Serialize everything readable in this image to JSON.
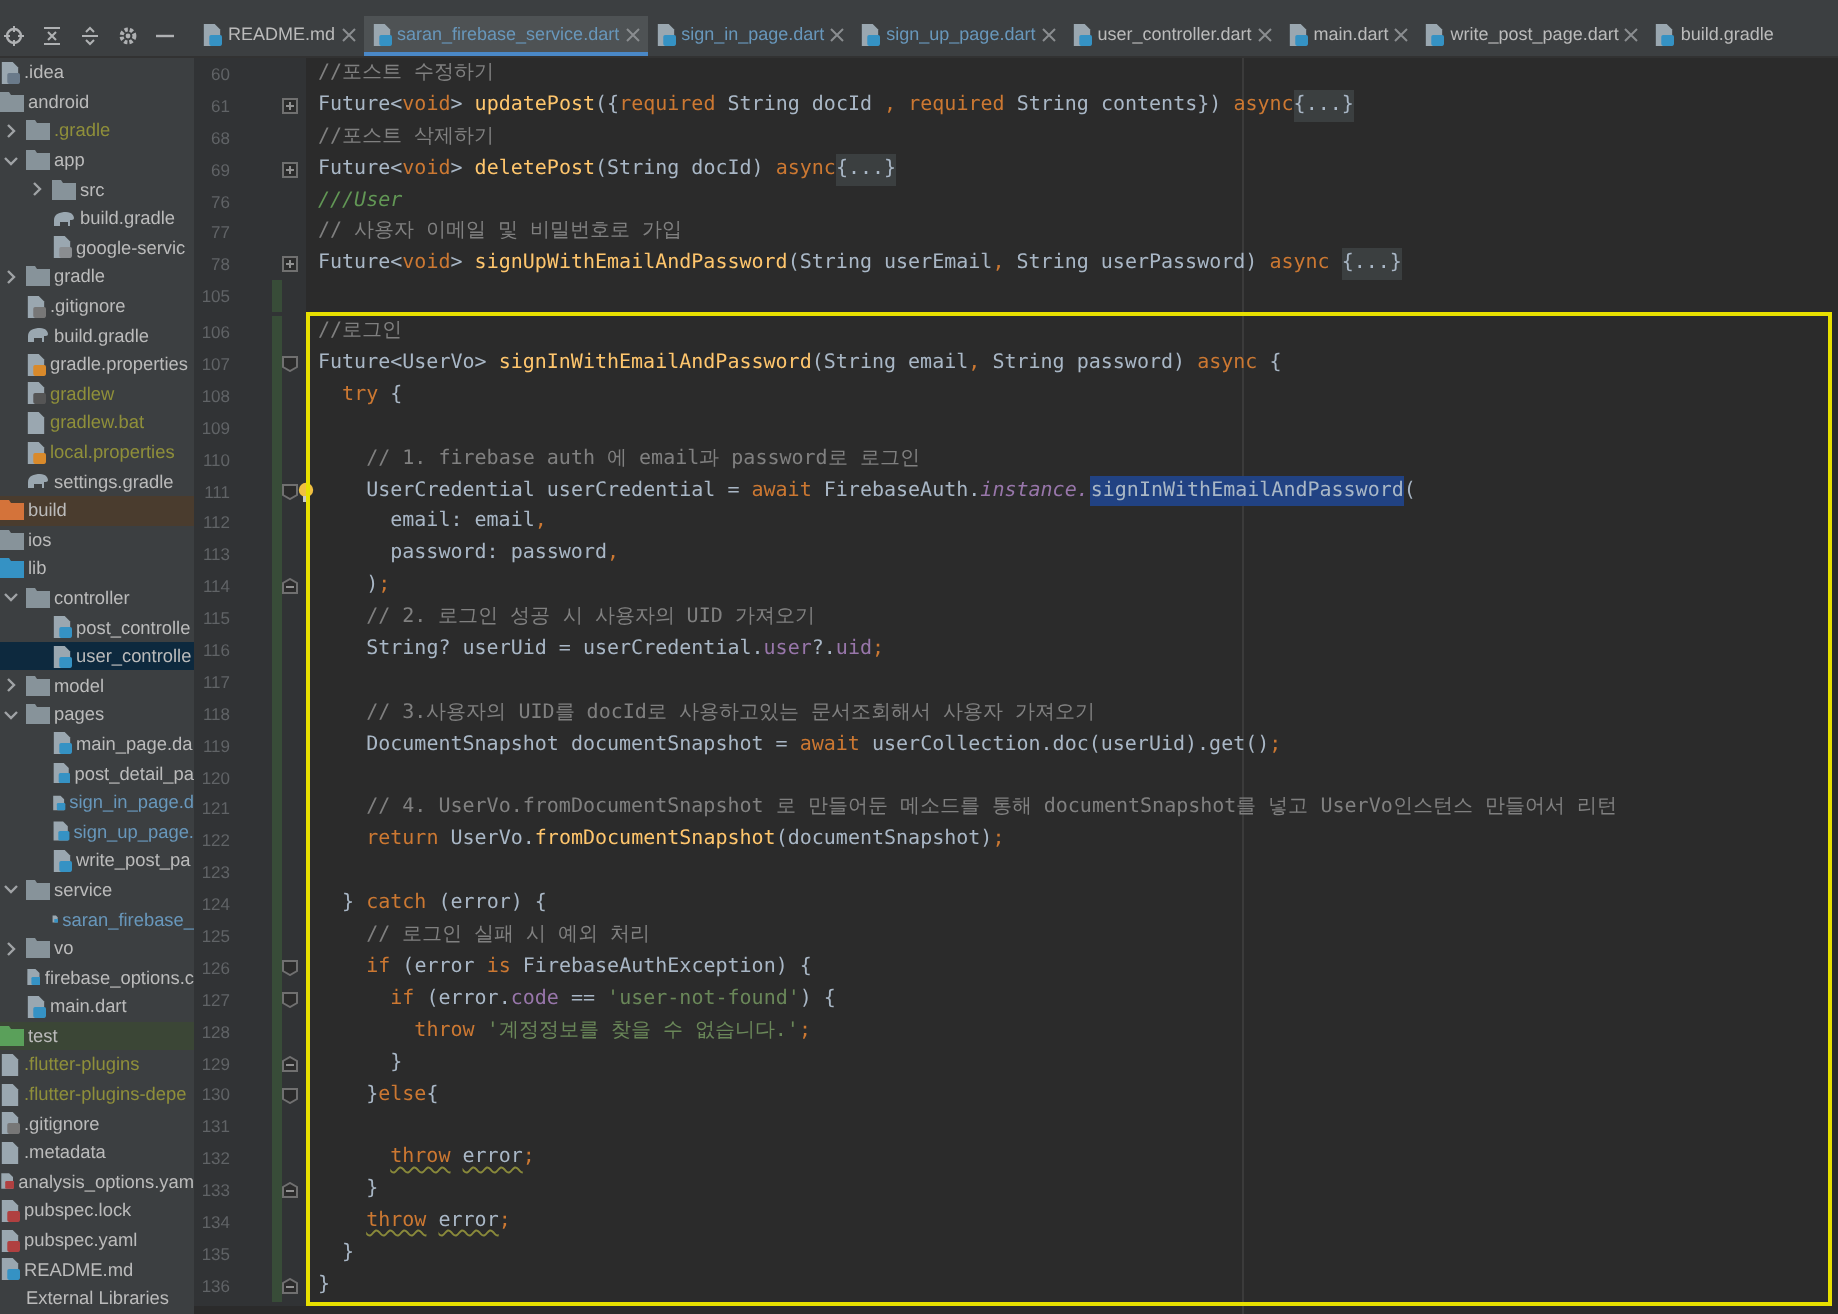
{
  "tabs": [
    {
      "label": "README.md",
      "color": "#bbbbbb",
      "selected": false
    },
    {
      "label": "saran_firebase_service.dart",
      "color": "#6897bb",
      "selected": true
    },
    {
      "label": "sign_in_page.dart",
      "color": "#6897bb",
      "selected": false
    },
    {
      "label": "sign_up_page.dart",
      "color": "#6897bb",
      "selected": false
    },
    {
      "label": "user_controller.dart",
      "color": "#bbbbbb",
      "selected": false
    },
    {
      "label": "main.dart",
      "color": "#bbbbbb",
      "selected": false
    },
    {
      "label": "write_post_page.dart",
      "color": "#bbbbbb",
      "selected": false
    },
    {
      "label": "build.gradle",
      "color": "#bbbbbb",
      "selected": false
    }
  ],
  "sidebar": {
    "tree": [
      {
        "label": ".idea",
        "kind": "module",
        "color": "#bbbbbb",
        "selected": false
      },
      {
        "label": "android",
        "kind": "folder",
        "color": "#bbbbbb",
        "selected": false,
        "children": [
          {
            "label": ".gradle",
            "kind": "folder",
            "color": "#8f8f3a",
            "selected": false,
            "expanded": false
          },
          {
            "label": "app",
            "kind": "folder",
            "color": "#bbbbbb",
            "selected": false,
            "expanded": true,
            "children": [
              {
                "label": "src",
                "kind": "folder",
                "color": "#bbbbbb",
                "selected": false,
                "expanded": false
              },
              {
                "label": "build.gradle",
                "kind": "gradle",
                "color": "#bbbbbb",
                "selected": false
              },
              {
                "label": "google-servic",
                "kind": "json",
                "color": "#bbbbbb",
                "selected": false
              }
            ]
          },
          {
            "label": "gradle",
            "kind": "folder",
            "color": "#bbbbbb",
            "selected": false,
            "expanded": false
          },
          {
            "label": ".gitignore",
            "kind": "ignorefile",
            "color": "#bbbbbb",
            "selected": false
          },
          {
            "label": "build.gradle",
            "kind": "gradle",
            "color": "#bbbbbb",
            "selected": false
          },
          {
            "label": "gradle.properties",
            "kind": "properties",
            "color": "#bbbbbb",
            "selected": false
          },
          {
            "label": "gradlew",
            "kind": "script",
            "color": "#8f8f3a",
            "selected": false
          },
          {
            "label": "gradlew.bat",
            "kind": "text",
            "color": "#8f8f3a",
            "selected": false
          },
          {
            "label": "local.properties",
            "kind": "properties",
            "color": "#8f8f3a",
            "selected": false
          },
          {
            "label": "settings.gradle",
            "kind": "gradle",
            "color": "#bbbbbb",
            "selected": false
          }
        ]
      },
      {
        "label": "build",
        "kind": "excluded-folder",
        "color": "#bbbbbb",
        "selected": false
      },
      {
        "label": "ios",
        "kind": "folder",
        "color": "#bbbbbb",
        "selected": false
      },
      {
        "label": "lib",
        "kind": "source-folder",
        "color": "#bbbbbb",
        "selected": false,
        "children": [
          {
            "label": "controller",
            "kind": "folder",
            "color": "#bbbbbb",
            "selected": false,
            "expanded": true,
            "children": [
              {
                "label": "post_controlle",
                "kind": "dart",
                "color": "#bbbbbb",
                "selected": false
              },
              {
                "label": "user_controlle",
                "kind": "dart",
                "color": "#bbbbbb",
                "selected": true
              }
            ]
          },
          {
            "label": "model",
            "kind": "folder",
            "color": "#bbbbbb",
            "selected": false,
            "expanded": false
          },
          {
            "label": "pages",
            "kind": "folder",
            "color": "#bbbbbb",
            "selected": false,
            "expanded": true,
            "children": [
              {
                "label": "main_page.da",
                "kind": "dart",
                "color": "#bbbbbb",
                "selected": false
              },
              {
                "label": "post_detail_pa",
                "kind": "dart",
                "color": "#bbbbbb",
                "selected": false
              },
              {
                "label": "sign_in_page.d",
                "kind": "dart",
                "color": "#6897bb",
                "selected": false
              },
              {
                "label": "sign_up_page.",
                "kind": "dart",
                "color": "#6897bb",
                "selected": false
              },
              {
                "label": "write_post_pa",
                "kind": "dart",
                "color": "#bbbbbb",
                "selected": false
              }
            ]
          },
          {
            "label": "service",
            "kind": "folder",
            "color": "#bbbbbb",
            "selected": false,
            "expanded": true,
            "children": [
              {
                "label": "saran_firebase_",
                "kind": "dart",
                "color": "#6897bb",
                "selected": false
              }
            ]
          },
          {
            "label": "vo",
            "kind": "folder",
            "color": "#bbbbbb",
            "selected": false,
            "expanded": false
          },
          {
            "label": "firebase_options.c",
            "kind": "dart",
            "color": "#bbbbbb",
            "selected": false
          },
          {
            "label": "main.dart",
            "kind": "dart",
            "color": "#bbbbbb",
            "selected": false
          }
        ]
      },
      {
        "label": "test",
        "kind": "test-folder",
        "color": "#bbbbbb",
        "selected": false
      },
      {
        "label": ".flutter-plugins",
        "kind": "text",
        "color": "#8f8f3a",
        "selected": false
      },
      {
        "label": ".flutter-plugins-depe",
        "kind": "text",
        "color": "#8f8f3a",
        "selected": false
      },
      {
        "label": ".gitignore",
        "kind": "ignorefile",
        "color": "#bbbbbb",
        "selected": false
      },
      {
        "label": ".metadata",
        "kind": "text",
        "color": "#bbbbbb",
        "selected": false
      },
      {
        "label": "analysis_options.yam",
        "kind": "yaml",
        "color": "#bbbbbb",
        "selected": false
      },
      {
        "label": "pubspec.lock",
        "kind": "yaml",
        "color": "#bbbbbb",
        "selected": false
      },
      {
        "label": "pubspec.yaml",
        "kind": "yaml",
        "color": "#bbbbbb",
        "selected": false
      },
      {
        "label": "README.md",
        "kind": "markdown",
        "color": "#bbbbbb",
        "selected": false
      },
      {
        "label": "External Libraries",
        "kind": "library",
        "color": "#bbbbbb",
        "selected": false
      }
    ]
  },
  "editor": {
    "lines": [
      {
        "number": "60",
        "kind": "plain",
        "changed": false,
        "bulb": false,
        "tokens": [
          {
            "kind": "comment",
            "text": "//포스트 수정하기"
          }
        ]
      },
      {
        "number": "61",
        "kind": "collapsed",
        "changed": false,
        "bulb": false,
        "tokens": [
          {
            "kind": "plain",
            "text": "Future<"
          },
          {
            "kind": "keyword",
            "text": "void"
          },
          {
            "kind": "plain",
            "text": "> "
          },
          {
            "kind": "function",
            "text": "updatePost"
          },
          {
            "kind": "plain",
            "text": "({"
          },
          {
            "kind": "keyword",
            "text": "required"
          },
          {
            "kind": "plain",
            "text": " String docId "
          },
          {
            "kind": "keyword",
            "text": ","
          },
          {
            "kind": "keyword",
            "text": " required"
          },
          {
            "kind": "plain",
            "text": " String contents}) "
          },
          {
            "kind": "keyword",
            "text": "async"
          },
          {
            "kind": "folded",
            "text": "{...}"
          }
        ]
      },
      {
        "number": "68",
        "kind": "plain",
        "changed": false,
        "bulb": false,
        "tokens": [
          {
            "kind": "comment",
            "text": "//포스트 삭제하기"
          }
        ]
      },
      {
        "number": "69",
        "kind": "collapsed",
        "changed": false,
        "bulb": false,
        "tokens": [
          {
            "kind": "plain",
            "text": "Future<"
          },
          {
            "kind": "keyword",
            "text": "void"
          },
          {
            "kind": "plain",
            "text": "> "
          },
          {
            "kind": "function",
            "text": "deletePost"
          },
          {
            "kind": "plain",
            "text": "(String docId) "
          },
          {
            "kind": "keyword",
            "text": "async"
          },
          {
            "kind": "folded",
            "text": "{...}"
          }
        ]
      },
      {
        "number": "76",
        "kind": "plain",
        "changed": false,
        "bulb": false,
        "tokens": [
          {
            "kind": "doc",
            "text": "///User"
          }
        ]
      },
      {
        "number": "77",
        "kind": "plain",
        "changed": false,
        "bulb": false,
        "tokens": [
          {
            "kind": "comment",
            "text": "// 사용자 이메일 및 비밀번호로 가입"
          }
        ]
      },
      {
        "number": "78",
        "kind": "collapsed",
        "changed": false,
        "bulb": false,
        "tokens": [
          {
            "kind": "plain",
            "text": "Future<"
          },
          {
            "kind": "keyword",
            "text": "void"
          },
          {
            "kind": "plain",
            "text": "> "
          },
          {
            "kind": "function",
            "text": "signUpWithEmailAndPassword"
          },
          {
            "kind": "plain",
            "text": "(String userEmail"
          },
          {
            "kind": "keyword",
            "text": ","
          },
          {
            "kind": "plain",
            "text": " String userPassword) "
          },
          {
            "kind": "keyword",
            "text": "async "
          },
          {
            "kind": "folded",
            "text": "{...}"
          }
        ]
      },
      {
        "number": "105",
        "kind": "plain",
        "changed": true,
        "bulb": false
      }
    ],
    "boxed_block": {
      "lines": [
        {
          "number": "106",
          "kind": "plain",
          "changed": true,
          "bulb": false,
          "tokens": [
            {
              "kind": "comment",
              "text": "//로그인"
            }
          ]
        },
        {
          "number": "107",
          "kind": "fold-start",
          "changed": true,
          "bulb": false,
          "tokens": [
            {
              "kind": "plain",
              "text": "Future<UserVo> "
            },
            {
              "kind": "function",
              "text": "signInWithEmailAndPassword"
            },
            {
              "kind": "plain",
              "text": "(String email"
            },
            {
              "kind": "keyword",
              "text": ","
            },
            {
              "kind": "plain",
              "text": " String password) "
            },
            {
              "kind": "keyword",
              "text": "async"
            },
            {
              "kind": "plain",
              "text": " {"
            }
          ]
        },
        {
          "number": "108",
          "kind": "plain",
          "changed": true,
          "bulb": false,
          "tokens": [
            {
              "kind": "keyword",
              "text": "  try"
            },
            {
              "kind": "plain",
              "text": " {"
            }
          ]
        },
        {
          "number": "109",
          "kind": "plain",
          "changed": true,
          "bulb": false
        },
        {
          "number": "110",
          "kind": "plain",
          "changed": true,
          "bulb": false,
          "tokens": [
            {
              "kind": "comment",
              "text": "    // 1. firebase auth 에 email과 password로 로그인"
            }
          ]
        },
        {
          "number": "111",
          "kind": "fold-start",
          "changed": true,
          "bulb": true,
          "tokens": [
            {
              "kind": "plain",
              "text": "    UserCredential userCredential = "
            },
            {
              "kind": "keyword",
              "text": "await"
            },
            {
              "kind": "plain",
              "text": " FirebaseAuth."
            },
            {
              "kind": "static",
              "text": "instance."
            },
            {
              "kind": "selection",
              "text": "signInWithEmailAndPassword"
            },
            {
              "kind": "plain",
              "text": "("
            }
          ]
        },
        {
          "number": "112",
          "kind": "plain",
          "changed": true,
          "bulb": false,
          "tokens": [
            {
              "kind": "plain",
              "text": "      email: email"
            },
            {
              "kind": "keyword",
              "text": ","
            }
          ]
        },
        {
          "number": "113",
          "kind": "plain",
          "changed": true,
          "bulb": false,
          "tokens": [
            {
              "kind": "plain",
              "text": "      password: password"
            },
            {
              "kind": "keyword",
              "text": ","
            }
          ]
        },
        {
          "number": "114",
          "kind": "fold-end",
          "changed": true,
          "bulb": false,
          "tokens": [
            {
              "kind": "plain",
              "text": "    )"
            },
            {
              "kind": "keyword",
              "text": ";"
            }
          ]
        },
        {
          "number": "115",
          "kind": "plain",
          "changed": true,
          "bulb": false,
          "tokens": [
            {
              "kind": "comment",
              "text": "    // 2. 로그인 성공 시 사용자의 UID 가져오기"
            }
          ]
        },
        {
          "number": "116",
          "kind": "plain",
          "changed": true,
          "bulb": false,
          "tokens": [
            {
              "kind": "plain",
              "text": "    String? userUid = userCredential."
            },
            {
              "kind": "field",
              "text": "user"
            },
            {
              "kind": "plain",
              "text": "?."
            },
            {
              "kind": "field",
              "text": "uid"
            },
            {
              "kind": "keyword",
              "text": ";"
            }
          ]
        },
        {
          "number": "117",
          "kind": "plain",
          "changed": true,
          "bulb": false
        },
        {
          "number": "118",
          "kind": "plain",
          "changed": true,
          "bulb": false,
          "tokens": [
            {
              "kind": "comment",
              "text": "    // 3.사용자의 UID를 docId로 사용하고있는 문서조회해서 사용자 가져오기"
            }
          ]
        },
        {
          "number": "119",
          "kind": "plain",
          "changed": true,
          "bulb": false,
          "tokens": [
            {
              "kind": "plain",
              "text": "    DocumentSnapshot documentSnapshot = "
            },
            {
              "kind": "keyword",
              "text": "await"
            },
            {
              "kind": "plain",
              "text": " userCollection.doc(userUid).get()"
            },
            {
              "kind": "keyword",
              "text": ";"
            }
          ]
        },
        {
          "number": "120",
          "kind": "plain",
          "changed": true,
          "bulb": false
        },
        {
          "number": "121",
          "kind": "plain",
          "changed": true,
          "bulb": false,
          "tokens": [
            {
              "kind": "comment",
              "text": "    // 4. UserVo.fromDocumentSnapshot 로 만들어둔 메소드를 통해 documentSnapshot를 넣고 UserVo인스턴스 만들어서 리턴"
            }
          ]
        },
        {
          "number": "122",
          "kind": "plain",
          "changed": true,
          "bulb": false,
          "tokens": [
            {
              "kind": "keyword",
              "text": "    return"
            },
            {
              "kind": "plain",
              "text": " UserVo."
            },
            {
              "kind": "function",
              "text": "fromDocumentSnapshot"
            },
            {
              "kind": "plain",
              "text": "(documentSnapshot)"
            },
            {
              "kind": "keyword",
              "text": ";"
            }
          ]
        },
        {
          "number": "123",
          "kind": "plain",
          "changed": true,
          "bulb": false
        },
        {
          "number": "124",
          "kind": "plain",
          "changed": true,
          "bulb": false,
          "tokens": [
            {
              "kind": "plain",
              "text": "  } "
            },
            {
              "kind": "keyword",
              "text": "catch"
            },
            {
              "kind": "plain",
              "text": " (error) {"
            }
          ]
        },
        {
          "number": "125",
          "kind": "plain",
          "changed": true,
          "bulb": false,
          "tokens": [
            {
              "kind": "comment",
              "text": "    // 로그인 실패 시 예외 처리"
            }
          ]
        },
        {
          "number": "126",
          "kind": "fold-start",
          "changed": true,
          "bulb": false,
          "tokens": [
            {
              "kind": "keyword",
              "text": "    if"
            },
            {
              "kind": "plain",
              "text": " (error "
            },
            {
              "kind": "keyword",
              "text": "is"
            },
            {
              "kind": "plain",
              "text": " FirebaseAuthException) {"
            }
          ]
        },
        {
          "number": "127",
          "kind": "fold-start",
          "changed": true,
          "bulb": false,
          "tokens": [
            {
              "kind": "keyword",
              "text": "      if"
            },
            {
              "kind": "plain",
              "text": " (error."
            },
            {
              "kind": "field",
              "text": "code"
            },
            {
              "kind": "plain",
              "text": " == "
            },
            {
              "kind": "string",
              "text": "'user-not-found'"
            },
            {
              "kind": "plain",
              "text": ") {"
            }
          ]
        },
        {
          "number": "128",
          "kind": "plain",
          "changed": true,
          "bulb": false,
          "tokens": [
            {
              "kind": "keyword",
              "text": "        throw"
            },
            {
              "kind": "string",
              "text": " '계정정보를 찾을 수 없습니다.'"
            },
            {
              "kind": "keyword",
              "text": ";"
            }
          ]
        },
        {
          "number": "129",
          "kind": "fold-end",
          "changed": true,
          "bulb": false,
          "tokens": [
            {
              "kind": "plain",
              "text": "      }"
            }
          ]
        },
        {
          "number": "130",
          "kind": "fold-start",
          "changed": true,
          "bulb": false,
          "tokens": [
            {
              "kind": "plain",
              "text": "    }"
            },
            {
              "kind": "keyword",
              "text": "else"
            },
            {
              "kind": "plain",
              "text": "{"
            }
          ]
        },
        {
          "number": "131",
          "kind": "plain",
          "changed": true,
          "bulb": false
        },
        {
          "number": "132",
          "kind": "plain",
          "changed": true,
          "bulb": false,
          "tokens": [
            {
              "kind": "warn-keyword",
              "text": "      throw"
            },
            {
              "kind": "warn",
              "text": " error"
            },
            {
              "kind": "keyword",
              "text": ";"
            }
          ]
        },
        {
          "number": "133",
          "kind": "fold-end",
          "changed": true,
          "bulb": false,
          "tokens": [
            {
              "kind": "plain",
              "text": "    }"
            }
          ]
        },
        {
          "number": "134",
          "kind": "plain",
          "changed": true,
          "bulb": false,
          "tokens": [
            {
              "kind": "warn-keyword",
              "text": "    throw"
            },
            {
              "kind": "warn",
              "text": " error"
            },
            {
              "kind": "keyword",
              "text": ";"
            }
          ]
        },
        {
          "number": "135",
          "kind": "plain",
          "changed": true,
          "bulb": false,
          "tokens": [
            {
              "kind": "plain",
              "text": "  }"
            }
          ]
        },
        {
          "number": "136",
          "kind": "fold-end",
          "changed": true,
          "bulb": false,
          "tokens": [
            {
              "kind": "plain",
              "text": "}"
            }
          ]
        }
      ]
    }
  }
}
